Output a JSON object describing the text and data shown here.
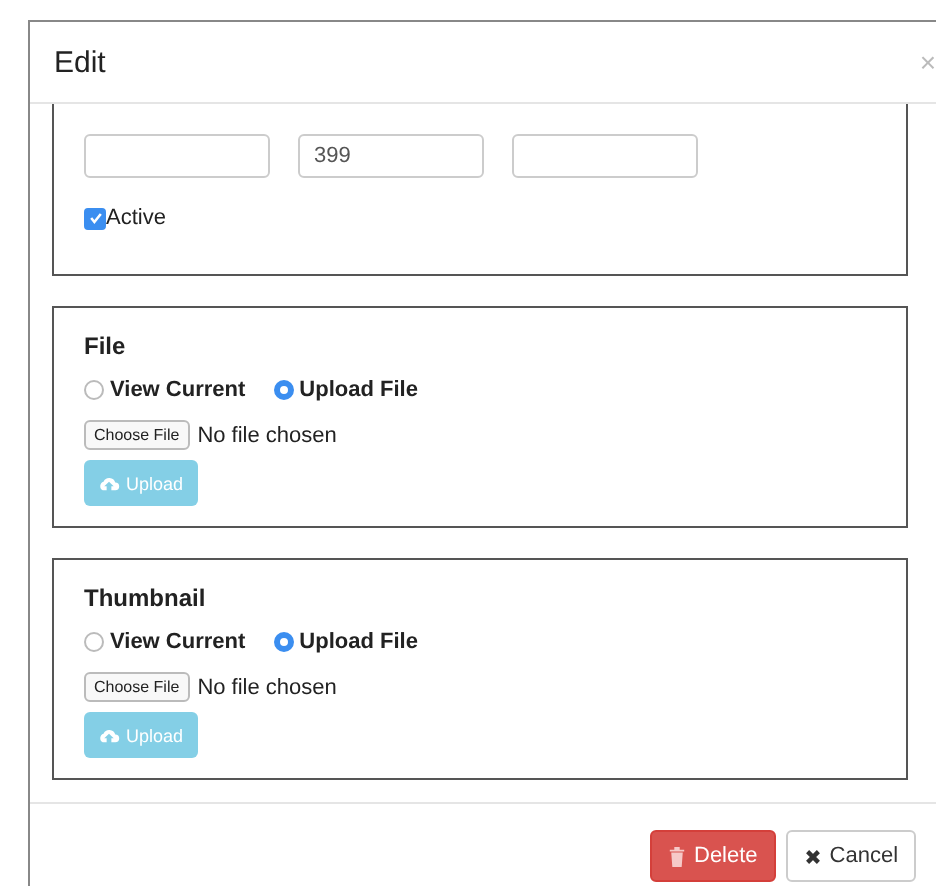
{
  "modal": {
    "title": "Edit",
    "close": "×"
  },
  "price_panel": {
    "inputs": [
      {
        "kind": "empty"
      },
      {
        "kind": "filled",
        "value": "399"
      },
      {
        "kind": "empty"
      }
    ],
    "active": {
      "label": "Active",
      "checked": true
    }
  },
  "upload_panels": [
    {
      "title": "File",
      "options": [
        {
          "label": "View Current",
          "selected": false
        },
        {
          "label": "Upload File",
          "selected": true
        }
      ],
      "file_button": "Choose File",
      "file_status": "No file chosen",
      "upload": {
        "label": "Upload",
        "disabled": true
      }
    },
    {
      "title": "Thumbnail",
      "options": [
        {
          "label": "View Current",
          "selected": false
        },
        {
          "label": "Upload File",
          "selected": true
        }
      ],
      "file_button": "Choose File",
      "file_status": "No file chosen",
      "upload": {
        "label": "Upload",
        "disabled": true
      }
    }
  ],
  "footer": {
    "buttons": [
      {
        "kind": "delete",
        "label": "Delete"
      },
      {
        "kind": "cancel",
        "label": "Cancel"
      }
    ]
  }
}
